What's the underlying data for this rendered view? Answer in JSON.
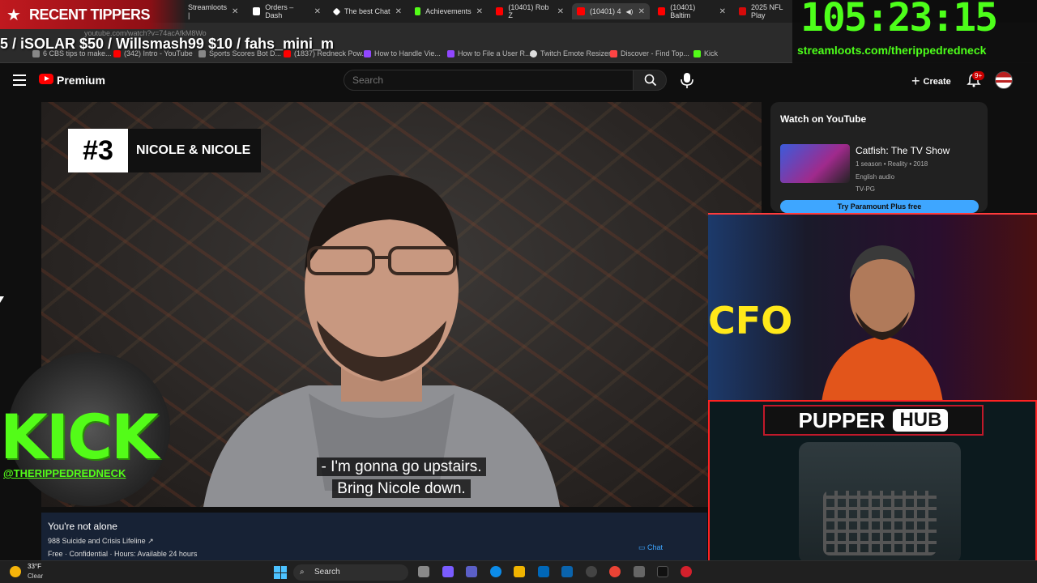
{
  "browser": {
    "tabs": [
      {
        "label": "Streamloots |",
        "color": "#6c4bd6"
      },
      {
        "label": "Orders – Dash",
        "color": "#ffffff"
      },
      {
        "label": "The best Chat",
        "color": "#ffffff"
      },
      {
        "label": "Achievements",
        "color": "#53fc18"
      },
      {
        "label": "(10401) Rob Z",
        "color": "#ff0000"
      },
      {
        "label": "(10401) 4",
        "color": "#ff0000"
      },
      {
        "label": "(10401) Baltim",
        "color": "#ff0000"
      },
      {
        "label": "2025 NFL Play",
        "color": "#d50a0a"
      }
    ],
    "url": "youtube.com/watch?v=74acAfkM8Wo",
    "bookmarks": [
      {
        "label": "6 CBS tips to make...",
        "color": "#888"
      },
      {
        "label": "(342) Intro - YouTube",
        "color": "#ff0000"
      },
      {
        "label": "Sports Scores Bot D...",
        "color": "#888"
      },
      {
        "label": "(1837) Redneck Pow...",
        "color": "#ff0000"
      },
      {
        "label": "How to Handle Vie...",
        "color": "#9147ff"
      },
      {
        "label": "How to File a User R...",
        "color": "#9147ff"
      },
      {
        "label": "Twitch Emote Resizer",
        "color": "#dddddd"
      },
      {
        "label": "Discover - Find Top...",
        "color": "#ff4444"
      },
      {
        "label": "Kick",
        "color": "#53fc18"
      }
    ]
  },
  "youtube": {
    "brand": "Premium",
    "search_placeholder": "Search",
    "create_label": "Create",
    "notification_count": "9+"
  },
  "video": {
    "rank_number": "#3",
    "rank_name": "NICOLE & NICOLE",
    "subtitle_line1": "- I'm gonna go upstairs.",
    "subtitle_line2": "Bring Nicole down."
  },
  "info_panel": {
    "title": "You're not alone",
    "line1": "988 Suicide and Crisis Lifeline ↗",
    "line2": "Free · Confidential · Hours: Available 24 hours",
    "chat": "Chat"
  },
  "watch_card": {
    "heading": "Watch on YouTube",
    "show_title": "Catfish: The TV Show",
    "meta1": "1 season • Reality • 2018",
    "meta2": "English audio",
    "meta3": "TV-PG",
    "cta": "Try Paramount Plus free"
  },
  "overlay": {
    "tippers_label": "RECENT TIPPERS",
    "ticker": "5 / iSOLAR $50 / Willsmash99 $10 / fahs_mini_m",
    "timer": "105:23:15",
    "streamloots_url": "streamloots.com/therippedredneck",
    "kick_text": "KICK",
    "kick_handle": "@THERIPPEDREDNECK",
    "cam_sign": "CFO",
    "pupper": "PUPPER",
    "hub": "HUB"
  },
  "taskbar": {
    "temp": "33°F",
    "condition": "Clear",
    "search": "Search"
  },
  "colors": {
    "accent_green": "#4dff1a",
    "kick_green": "#53fc18",
    "youtube_red": "#ff0000",
    "tipper_red": "#c0191f"
  }
}
